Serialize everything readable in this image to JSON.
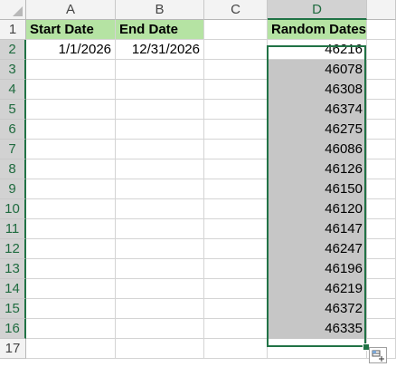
{
  "columns": [
    "A",
    "B",
    "C",
    "D"
  ],
  "rows": [
    "1",
    "2",
    "3",
    "4",
    "5",
    "6",
    "7",
    "8",
    "9",
    "10",
    "11",
    "12",
    "13",
    "14",
    "15",
    "16",
    "17"
  ],
  "headers": {
    "a1": "Start Date",
    "b1": "End Date",
    "d1": "Random Dates"
  },
  "values": {
    "start_date": "1/1/2026",
    "end_date": "12/31/2026"
  },
  "random_dates": [
    "46216",
    "46078",
    "46308",
    "46374",
    "46275",
    "46086",
    "46126",
    "46150",
    "46120",
    "46147",
    "46247",
    "46196",
    "46219",
    "46372",
    "46335"
  ],
  "colors": {
    "header_fill": "#b5e3a3",
    "selection_accent": "#217346",
    "selection_fill": "#c6c6c6"
  },
  "icons": {
    "quick_analysis": "quick-analysis-icon"
  }
}
